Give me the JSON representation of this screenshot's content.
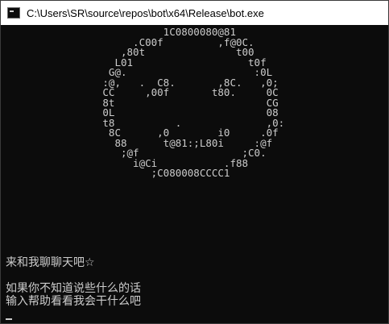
{
  "window": {
    "title": "C:\\Users\\SR\\source\\repos\\bot\\x64\\Release\\bot.exe",
    "icon": "console-app-icon"
  },
  "console": {
    "art_lines": [
      "                          1C0800080@81",
      "                     .C00f         ,f@0C.",
      "                   ,80t               t00",
      "                  L01                   t0f",
      "                 G@.                     :0L",
      "                :@,   .  C8.       ,8C.   ,0;",
      "                CC     ,00f       t80.     0C",
      "                8t                         CG",
      "                0L                         08",
      "                t8          .              ,0:",
      "                 8C      ,0        i0     .0f",
      "                  88      t@81:;L80i     :@f",
      "                   ;@f                 ;C0.",
      "                     i@Ci           .f88",
      "                        ;C080008CCCC1"
    ],
    "greeting": "来和我聊聊天吧☆",
    "hint_line_1": "如果你不知道说些什么的话",
    "hint_line_2": "输入帮助看看我会干什么吧"
  }
}
